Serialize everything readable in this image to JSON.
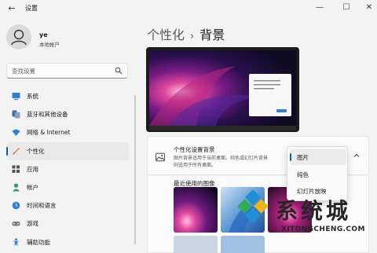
{
  "window": {
    "back_glyph": "←",
    "title": "设置",
    "minimize_glyph": "—",
    "maximize_glyph": "☐",
    "close_glyph": "✕"
  },
  "user": {
    "name": "ye",
    "account_type": "本地帐户"
  },
  "search": {
    "placeholder": "查找设置"
  },
  "sidebar": {
    "items": [
      {
        "label": "系统",
        "icon": "system-icon"
      },
      {
        "label": "蓝牙和其他设备",
        "icon": "bluetooth-icon"
      },
      {
        "label": "网络 & Internet",
        "icon": "network-icon"
      },
      {
        "label": "个性化",
        "icon": "personalization-icon",
        "selected": true
      },
      {
        "label": "应用",
        "icon": "apps-icon"
      },
      {
        "label": "帐户",
        "icon": "accounts-icon"
      },
      {
        "label": "时间和语言",
        "icon": "time-language-icon"
      },
      {
        "label": "游戏",
        "icon": "gaming-icon"
      },
      {
        "label": "辅助功能",
        "icon": "accessibility-icon"
      }
    ]
  },
  "breadcrumb": {
    "parent": "个性化",
    "separator": "›",
    "current": "背景"
  },
  "background_card": {
    "title": "个性化设置背景",
    "description": "图片背景适用于当前桌面。纯色或幻灯片背景则适用于所有桌面。",
    "recent_label": "最近使用的图像"
  },
  "dropdown": {
    "options": [
      "图片",
      "纯色",
      "幻灯片放映"
    ],
    "selected": "图片"
  },
  "watermark": {
    "text": "系统城",
    "url": "XITONGCHENG.COM"
  },
  "colors": {
    "accent": "#005fb8",
    "window_bg": "#f3f3f3",
    "card_bg": "#fbfbfb"
  }
}
